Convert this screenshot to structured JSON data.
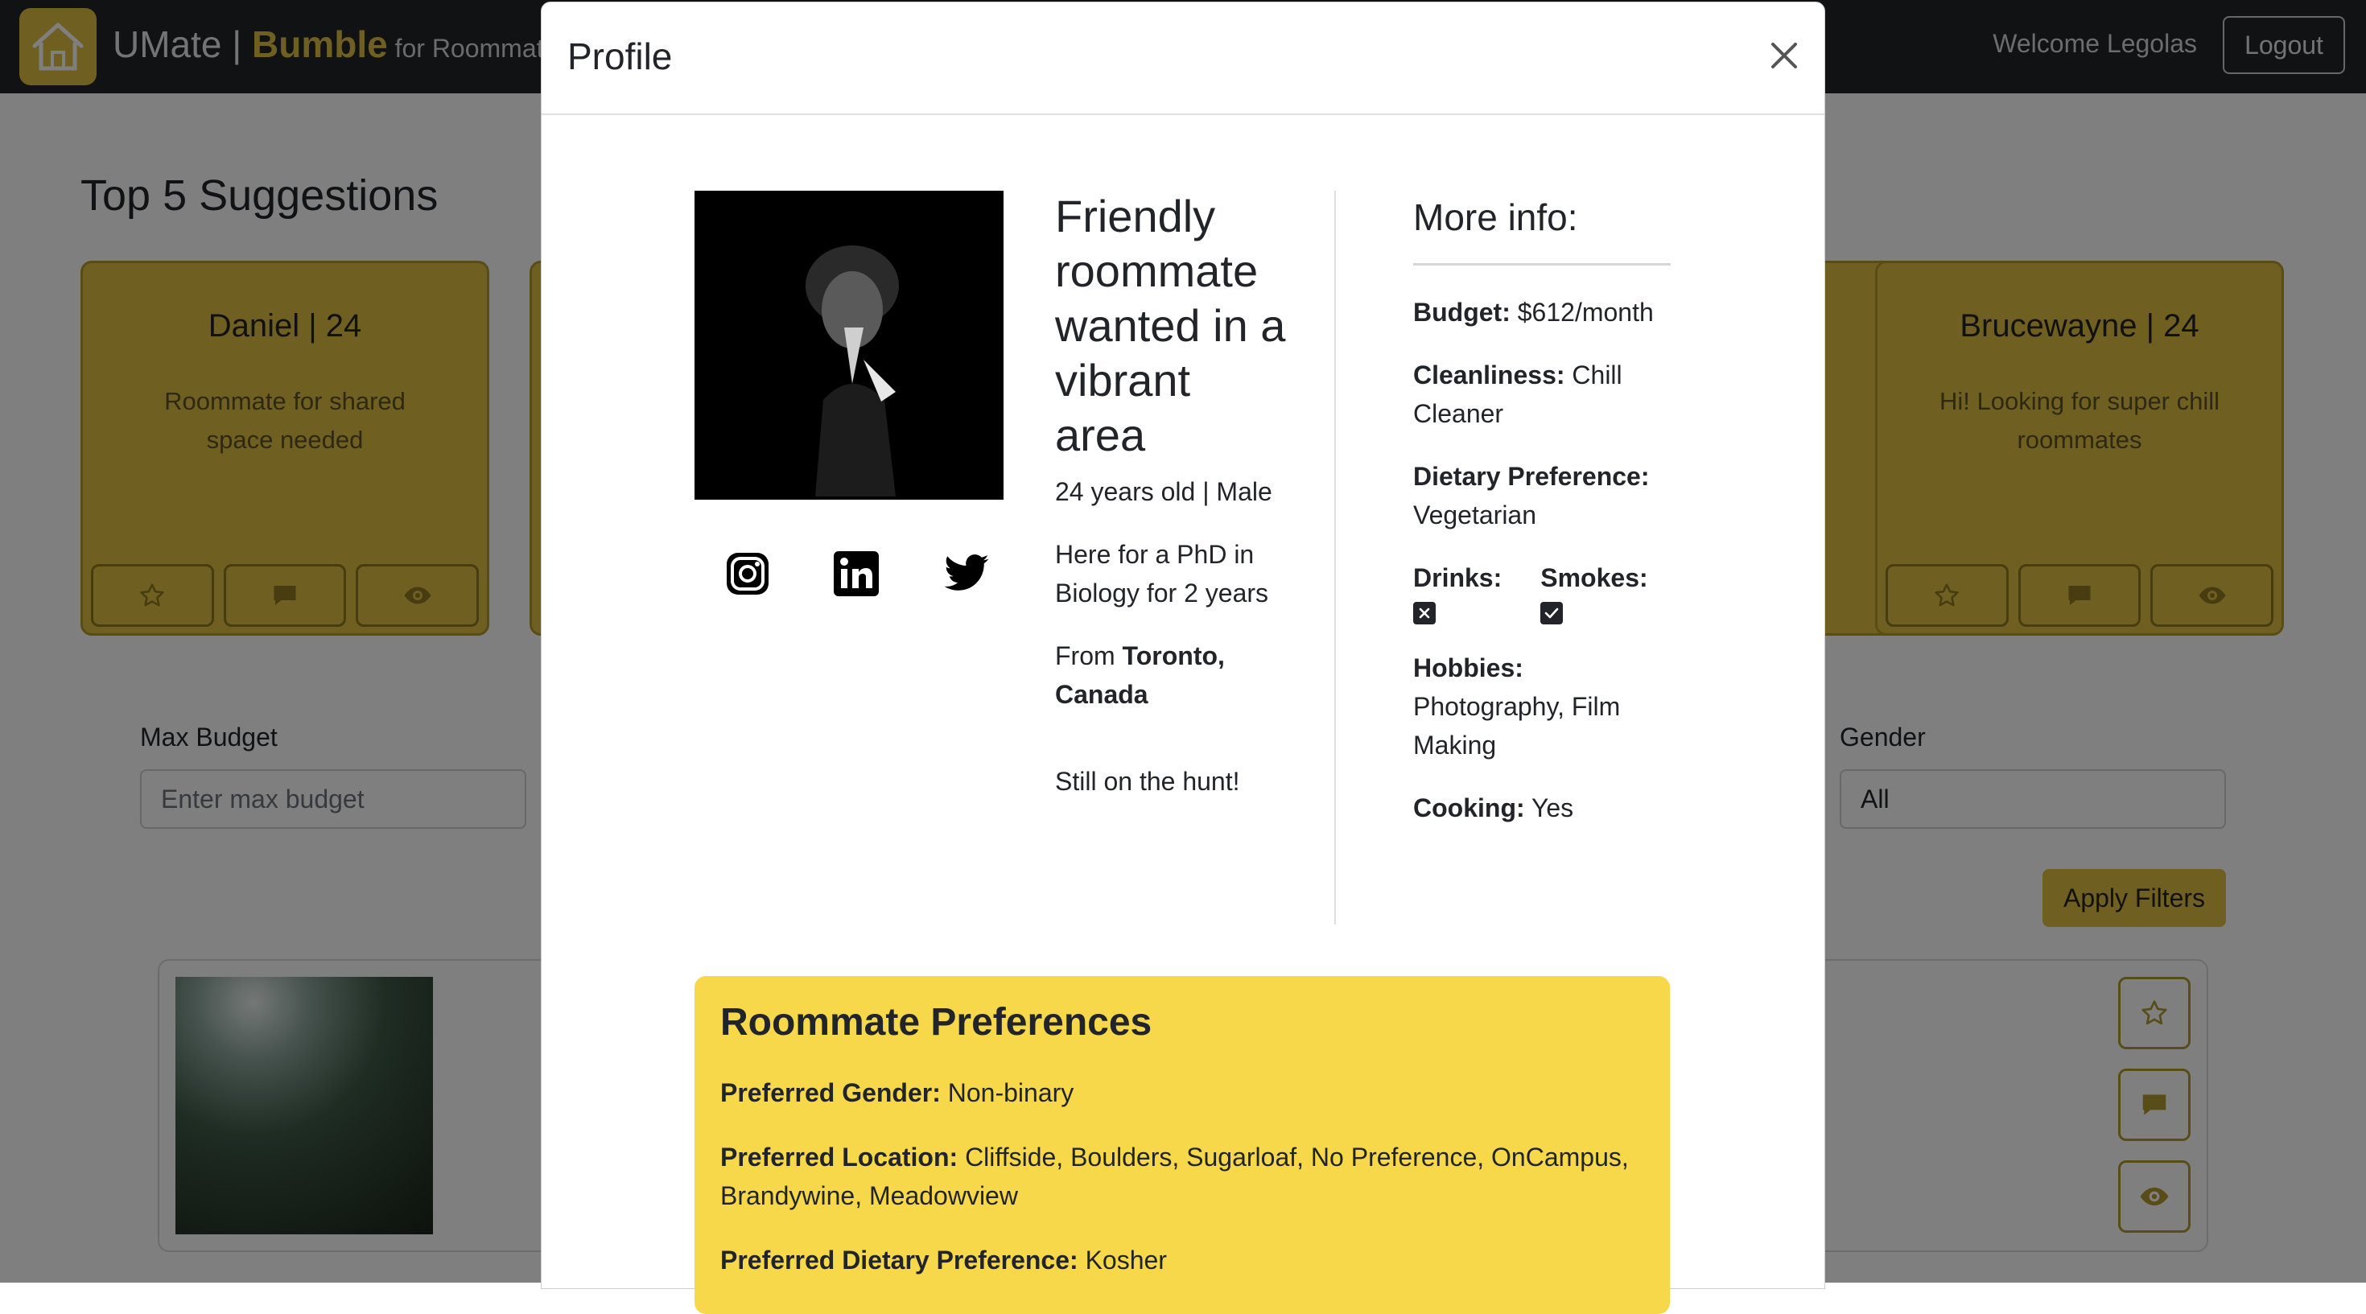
{
  "colors": {
    "accent": "#dfc043",
    "navbar": "#212529",
    "prefs_bg": "#f7d84b"
  },
  "navbar": {
    "brand_main": "UMate | ",
    "brand_bumble": "Bumble",
    "brand_sub": " for Roommat",
    "welcome": "Welcome Legolas",
    "logout": "Logout"
  },
  "suggestions": {
    "title": "Top 5 Suggestions",
    "cards": [
      {
        "name": "Daniel | 24",
        "text": "Roommate for shared space needed"
      },
      {
        "name": "Brucewayne | 24",
        "text": "Hi! Looking for super chill roommates"
      }
    ]
  },
  "filters": {
    "max_budget_label": "Max Budget",
    "max_budget_placeholder": "Enter max budget",
    "gender_label": "Gender",
    "gender_value": "All",
    "apply": "Apply Filters"
  },
  "modal": {
    "title": "Profile",
    "headline": "Friendly roommate wanted in a vibrant area",
    "age_gender": "24 years old | Male",
    "purpose": "Here for a PhD in Biology for 2 years",
    "from_prefix": "From ",
    "from_location": "Toronto, Canada",
    "status": "Still on the hunt!",
    "social_icons": [
      "instagram-icon",
      "linkedin-icon",
      "twitter-icon"
    ],
    "more_info": {
      "title": "More info:",
      "budget_label": "Budget:",
      "budget_value": " $612/month",
      "cleanliness_label": "Cleanliness:",
      "cleanliness_value": " Chill Cleaner",
      "dietary_label": "Dietary Preference:",
      "dietary_value": " Vegetarian",
      "drinks_label": "Drinks:",
      "smokes_label": "Smokes:",
      "hobbies_label": "Hobbies:",
      "hobbies_value": " Photography, Film Making",
      "cooking_label": "Cooking:",
      "cooking_value": " Yes"
    },
    "preferences": {
      "title": "Roommate Preferences",
      "gender_label": "Preferred Gender:",
      "gender_value": " Non-binary",
      "location_label": "Preferred Location:",
      "location_value": " Cliffside, Boulders, Sugarloaf, No Preference, OnCampus, Brandywine, Meadowview",
      "dietary_label": "Preferred Dietary Preference:",
      "dietary_value": " Kosher"
    }
  }
}
